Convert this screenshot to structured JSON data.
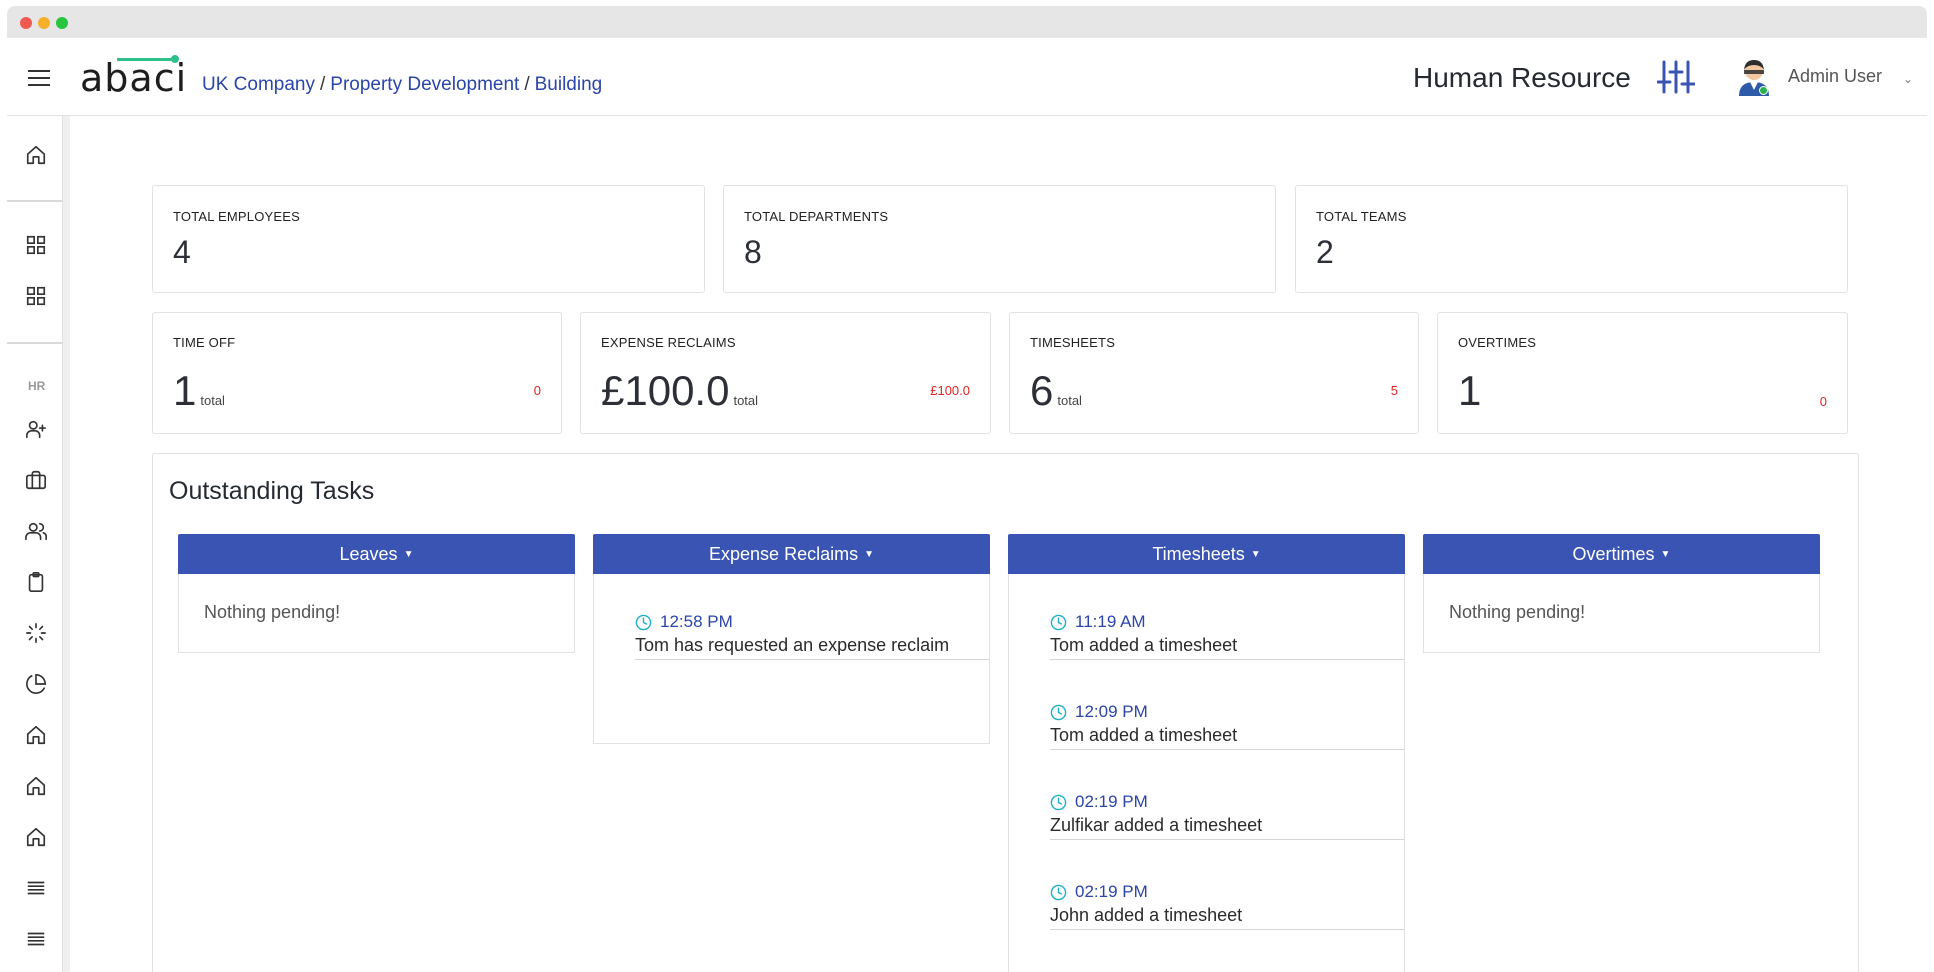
{
  "header": {
    "logo": "abaci",
    "breadcrumb": [
      "UK Company",
      "Property Development",
      "Building"
    ],
    "module_title": "Human Resource",
    "module_icon": "sliders-icon",
    "user_name": "Admin User"
  },
  "sidebar": {
    "section_label": "HR",
    "icons": [
      "home-icon",
      "grid-icon",
      "grid-icon",
      "user-plus-icon",
      "briefcase-icon",
      "users-icon",
      "clipboard-icon",
      "loader-icon",
      "pie-chart-icon",
      "home-icon",
      "home-icon",
      "home-icon",
      "list-icon",
      "list-icon"
    ]
  },
  "stats_top": [
    {
      "label": "TOTAL EMPLOYEES",
      "value": "4"
    },
    {
      "label": "TOTAL DEPARTMENTS",
      "value": "8"
    },
    {
      "label": "TOTAL TEAMS",
      "value": "2"
    }
  ],
  "stats_bottom": [
    {
      "label": "TIME OFF",
      "value": "1",
      "total": "total",
      "pending": "0"
    },
    {
      "label": "EXPENSE RECLAIMS",
      "value": "£100.0",
      "total": "total",
      "pending": "£100.0"
    },
    {
      "label": "TIMESHEETS",
      "value": "6",
      "total": "total",
      "pending": "5"
    },
    {
      "label": "OVERTIMES",
      "value": "1",
      "total": "",
      "pending": "0"
    }
  ],
  "tasks": {
    "title": "Outstanding Tasks",
    "columns": [
      {
        "header": "Leaves",
        "empty_text": "Nothing pending!"
      },
      {
        "header": "Expense Reclaims",
        "entries": [
          {
            "time": "12:58 PM",
            "text": "Tom has requested an expense reclaim"
          }
        ]
      },
      {
        "header": "Timesheets",
        "entries": [
          {
            "time": "11:19 AM",
            "text": "Tom added a timesheet"
          },
          {
            "time": "12:09 PM",
            "text": "Tom added a timesheet"
          },
          {
            "time": "02:19 PM",
            "text": "Zulfikar added a timesheet"
          },
          {
            "time": "02:19 PM",
            "text": "John added a timesheet"
          }
        ]
      },
      {
        "header": "Overtimes",
        "empty_text": "Nothing pending!"
      }
    ]
  },
  "colors": {
    "primary": "#3a54b4",
    "link": "#2b45a8",
    "accent": "#2ec08a",
    "pending": "#e02424",
    "clock": "#1fb0c8"
  }
}
